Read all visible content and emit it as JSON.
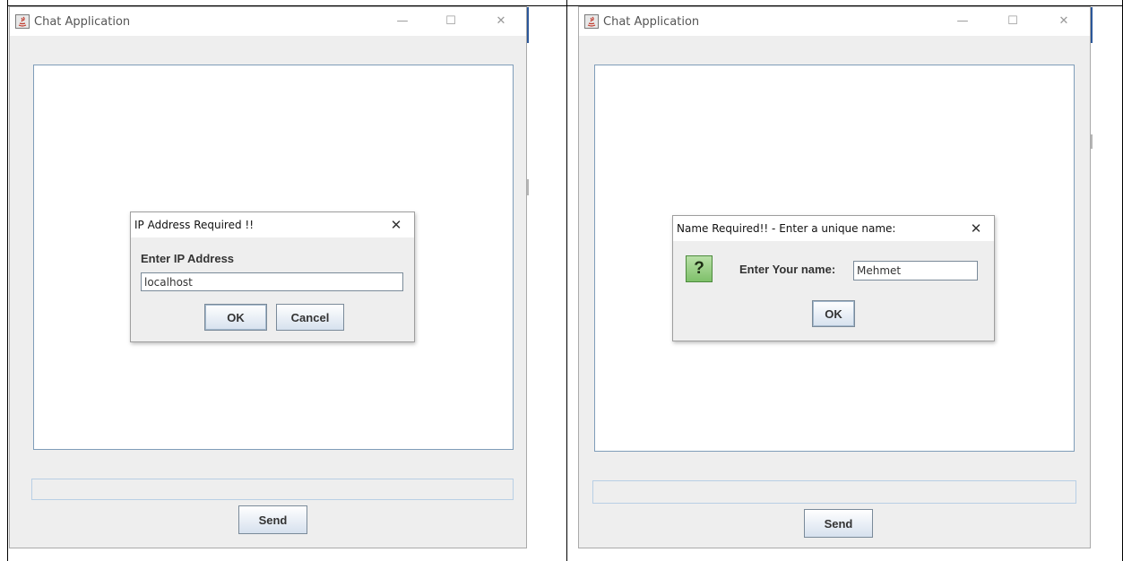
{
  "left_window": {
    "title": "Chat Application",
    "controls": {
      "minimize": "—",
      "maximize": "☐",
      "close": "✕"
    },
    "send_label": "Send",
    "dialog": {
      "title": "IP Address Required !!",
      "close": "✕",
      "prompt": "Enter IP Address",
      "value": "localhost",
      "ok_label": "OK",
      "cancel_label": "Cancel"
    }
  },
  "right_window": {
    "title": "Chat Application",
    "controls": {
      "minimize": "—",
      "maximize": "☐",
      "close": "✕"
    },
    "send_label": "Send",
    "dialog": {
      "title": "Name Required!! - Enter a unique name:",
      "close": "✕",
      "icon": "?",
      "prompt": "Enter Your name:",
      "value": "Mehmet",
      "ok_label": "OK"
    }
  },
  "colors": {
    "window_bg": "#eeeeee",
    "field_border": "#7f9db9",
    "button_gradient_bottom": "#d6e1ee",
    "question_icon_green": "#7fc06a"
  }
}
